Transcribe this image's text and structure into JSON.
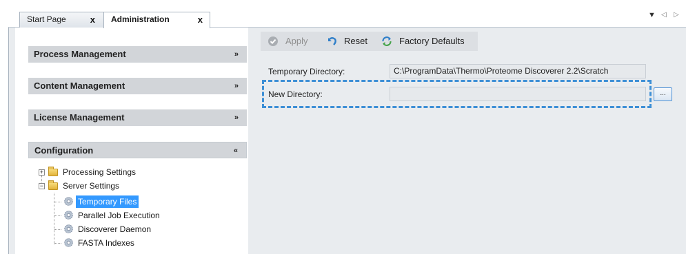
{
  "tabs": {
    "items": [
      {
        "label": "Start Page",
        "close": "x",
        "active": false
      },
      {
        "label": "Administration",
        "close": "x",
        "active": true
      }
    ],
    "controls": {
      "menu": "▼",
      "prev": "◁",
      "next": "▷"
    }
  },
  "sidebar": {
    "sections": [
      {
        "label": "Process Management",
        "chevron": "»",
        "expanded": false
      },
      {
        "label": "Content Management",
        "chevron": "»",
        "expanded": false
      },
      {
        "label": "License Management",
        "chevron": "»",
        "expanded": false
      },
      {
        "label": "Configuration",
        "chevron": "«",
        "expanded": true
      }
    ],
    "tree": [
      {
        "label": "Processing Settings",
        "expander": "+",
        "icon": "folder-icon"
      },
      {
        "label": "Server Settings",
        "expander": "−",
        "icon": "folder-icon"
      },
      {
        "label": "Temporary Files",
        "icon": "gear-icon",
        "selected": true
      },
      {
        "label": "Parallel Job Execution",
        "icon": "gear-icon"
      },
      {
        "label": "Discoverer Daemon",
        "icon": "gear-icon"
      },
      {
        "label": "FASTA Indexes",
        "icon": "gear-icon"
      }
    ]
  },
  "toolbar": {
    "apply_label": "Apply",
    "reset_label": "Reset",
    "factory_defaults_label": "Factory Defaults"
  },
  "form": {
    "temporary_directory_label": "Temporary Directory:",
    "temporary_directory_value": "C:\\ProgramData\\Thermo\\Proteome Discoverer 2.2\\Scratch",
    "new_directory_label": "New Directory:",
    "new_directory_value": "",
    "browse_label": "..."
  },
  "colors": {
    "accent_focus": "#3d8fd6",
    "selection": "#3399ff",
    "section_header": "#d2d5d9",
    "panel_background": "#e9ecef"
  }
}
